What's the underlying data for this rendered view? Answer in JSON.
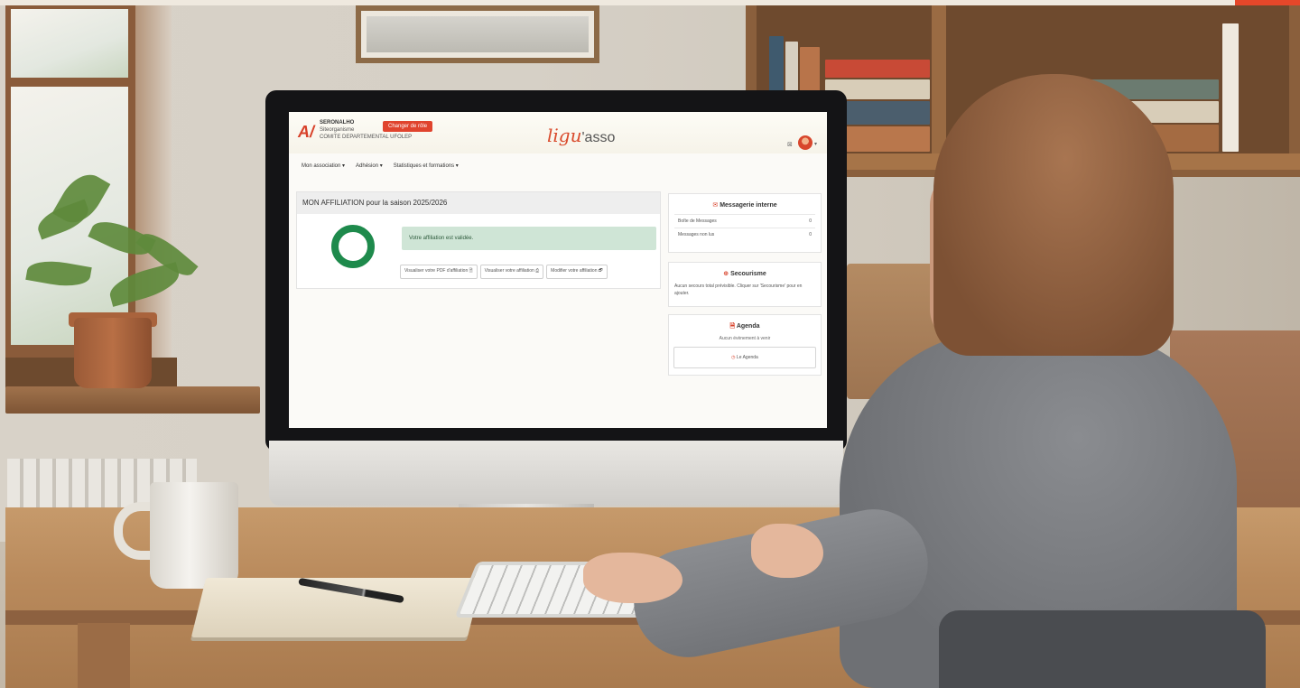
{
  "scene": {
    "description_tags": [
      "home-office",
      "monitor",
      "person-typing"
    ]
  },
  "app": {
    "logo_mark": "A/",
    "org": {
      "line1": "SERONALHO",
      "line2": "Siteorganisme",
      "line3": "COMITE DEPARTEMENTAL UFOLEP"
    },
    "change_button": "Changer de rôle",
    "brand_main": "ligu",
    "brand_sub": "'asso",
    "header_icon": "⊠",
    "avatar_caret": "▾",
    "nav": [
      "Mon association ▾",
      "Adhésion ▾",
      "Statistiques et formations ▾"
    ]
  },
  "affiliation": {
    "title": "MON AFFILIATION pour la saison 2025/2026",
    "status_text": "Votre affiliation est validée.",
    "actions": [
      "Visualiser votre PDF d'affiliation 🗎",
      "Visualiser votre affiliation ⎙",
      "Modifier votre affiliation 🗗"
    ]
  },
  "messages": {
    "icon": "✉",
    "title": "Messagerie interne",
    "rows": [
      {
        "label": "Boîte de Messages",
        "value": "0"
      },
      {
        "label": "Messages non lus",
        "value": "0"
      }
    ]
  },
  "secourisme": {
    "icon": "⊕",
    "title": "Secourisme",
    "text": "Aucun secours total  prévisible. Cliquer sur 'Secourisme' pour en ajouter."
  },
  "agenda": {
    "icon": "🗎",
    "title": "Agenda",
    "note": "Aucun évènement à venir",
    "button": "Le Agenda"
  },
  "colors": {
    "brand_red": "#d8412a",
    "success_green": "#1e8a4c",
    "success_bg": "#cfe5d6"
  }
}
